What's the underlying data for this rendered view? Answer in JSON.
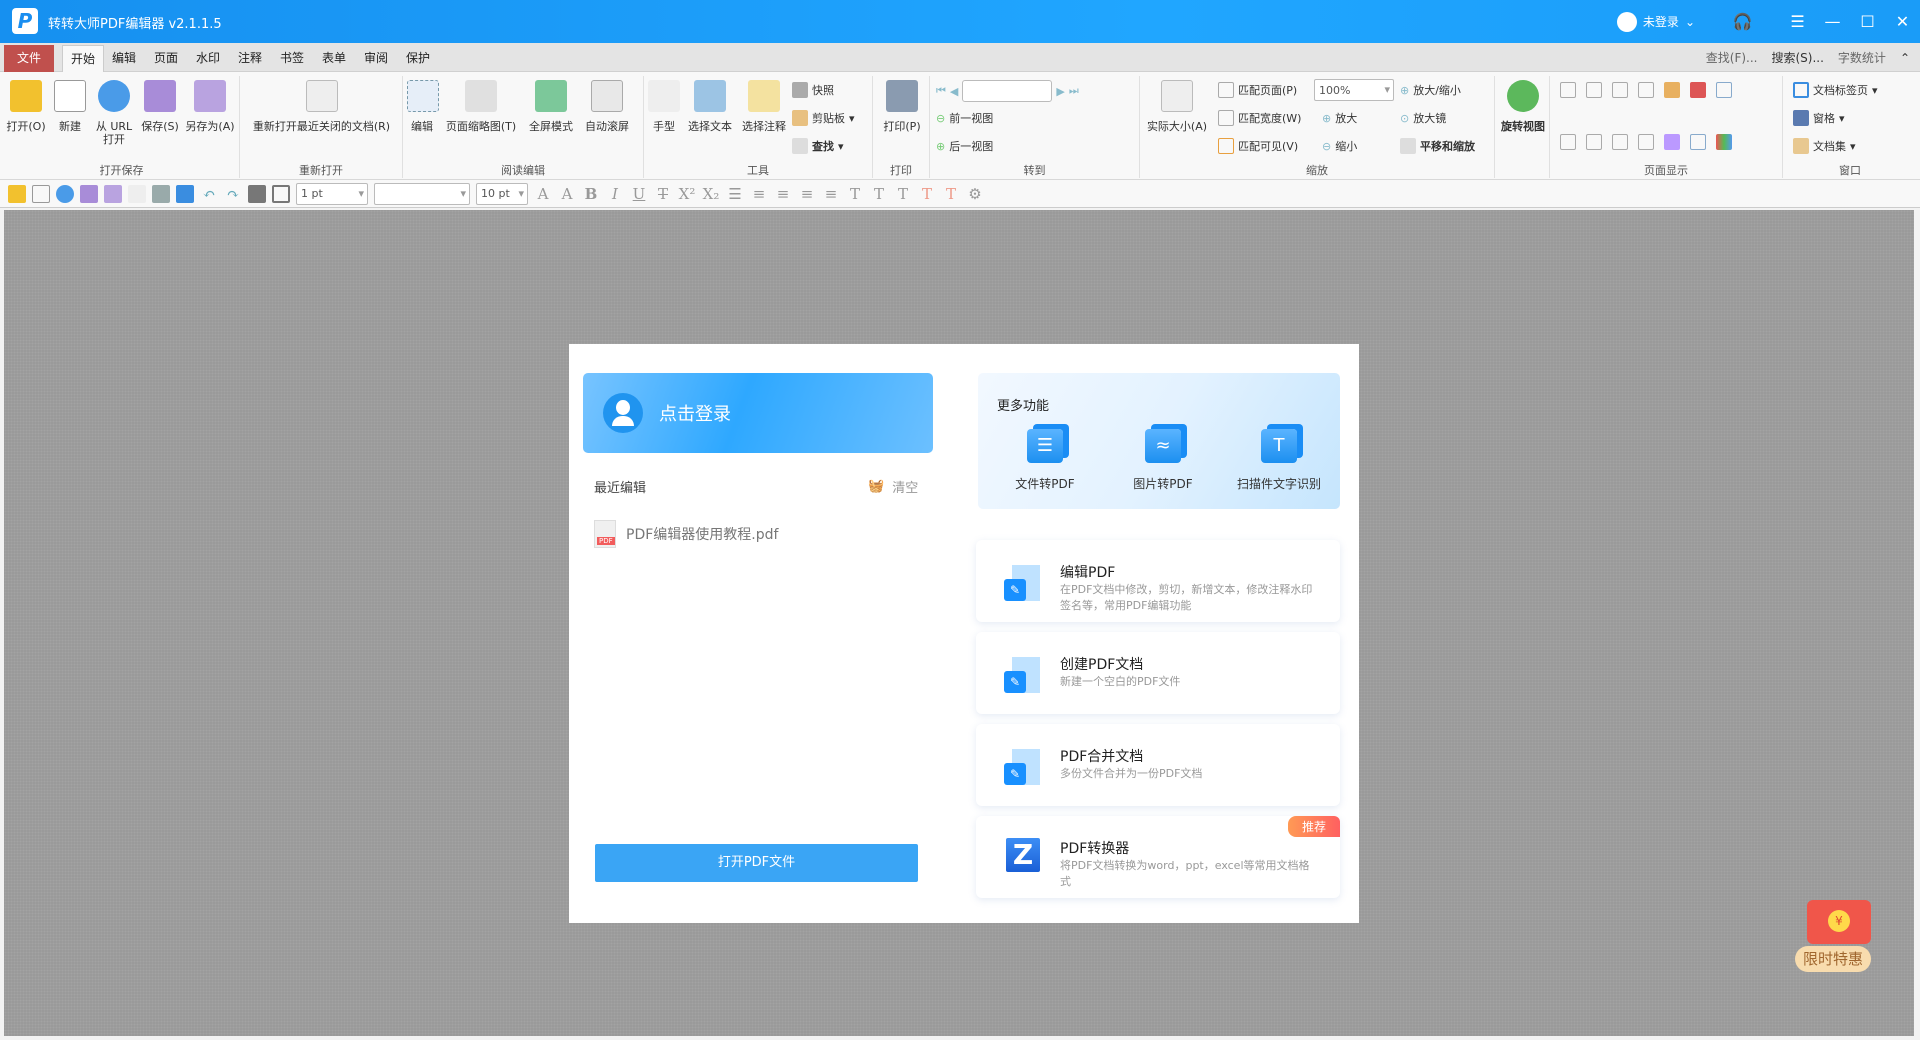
{
  "app": {
    "title": "转转大师PDF编辑器 v2.1.1.5",
    "user": "未登录",
    "win": {
      "menu": "☰",
      "min": "—",
      "max": "☐",
      "close": "✕"
    }
  },
  "menu": {
    "tabs": [
      "文件",
      "开始",
      "编辑",
      "页面",
      "水印",
      "注释",
      "书签",
      "表单",
      "审阅",
      "保护"
    ],
    "right": [
      "查找(F)...",
      "搜索(S)...",
      "字数统计"
    ]
  },
  "ribbon": {
    "groups": [
      "打开保存",
      "重新打开",
      "阅读编辑",
      "工具",
      "打印",
      "转到",
      "缩放",
      "页面显示",
      "窗口"
    ],
    "open": [
      "打开(O)",
      "新建",
      "从 URL 打开",
      "保存(S)",
      "另存为(A)"
    ],
    "reopen": "重新打开最近关闭的文档(R)",
    "read": [
      "编辑",
      "页面缩略图(T)",
      "全屏模式",
      "自动滚屏"
    ],
    "tools": [
      "手型",
      "选择文本",
      "选择注释"
    ],
    "tools_small": [
      "快照",
      "剪贴板",
      "查找"
    ],
    "print": "打印(P)",
    "goto": [
      "前一视图",
      "后一视图"
    ],
    "zoom": {
      "actual": "实际大小(A)",
      "fit": [
        "匹配页面(P)",
        "匹配宽度(W)",
        "匹配可见(V)"
      ],
      "value": "100%",
      "ops": [
        "放大/缩小",
        "放大",
        "缩小",
        "放大镜",
        "平移和缩放"
      ]
    },
    "rotate": "旋转视图",
    "window": [
      "文档标签页",
      "窗格",
      "文档集"
    ]
  },
  "quick": {
    "line_width": "1 pt",
    "font": "",
    "font_size": "10 pt"
  },
  "home": {
    "login": "点击登录",
    "recent_label": "最近编辑",
    "clear": "清空",
    "recent_files": [
      "PDF编辑器使用教程.pdf"
    ],
    "open_button": "打开PDF文件",
    "more_title": "更多功能",
    "more": [
      "文件转PDF",
      "图片转PDF",
      "扫描件文字识别"
    ],
    "cards": [
      {
        "title": "编辑PDF",
        "desc": "在PDF文档中修改，剪切，新增文本，修改注释水印签名等，常用PDF编辑功能"
      },
      {
        "title": "创建PDF文档",
        "desc": "新建一个空白的PDF文件"
      },
      {
        "title": "PDF合并文档",
        "desc": "多份文件合并为一份PDF文档"
      },
      {
        "title": "PDF转换器",
        "desc": "将PDF文档转换为word，ppt，excel等常用文档格式",
        "badge": "推荐"
      }
    ]
  },
  "promo": {
    "label": "限时特惠",
    "symbol": "¥"
  }
}
